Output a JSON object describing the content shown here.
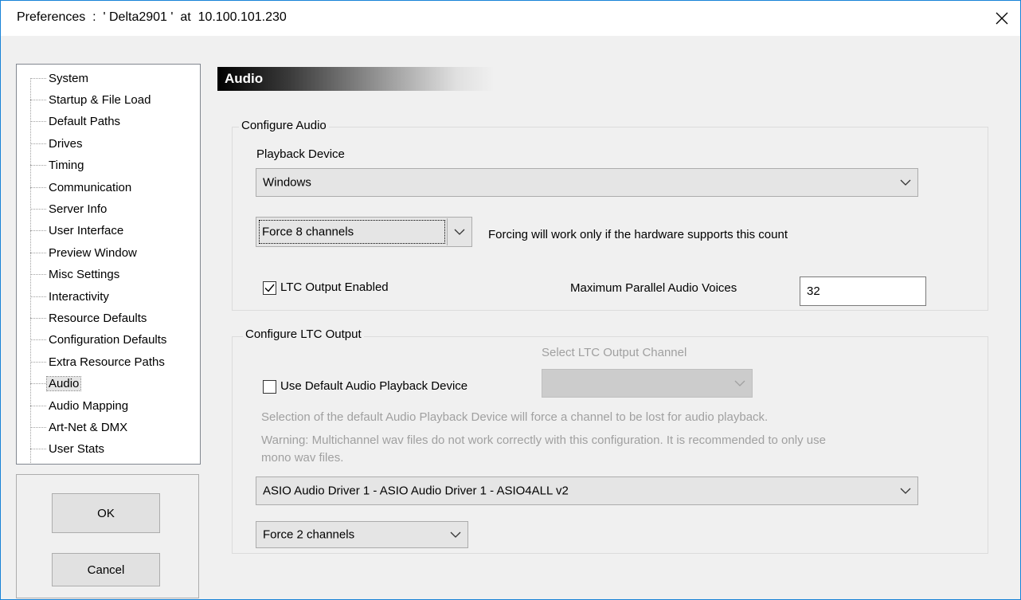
{
  "window": {
    "title": "Preferences  :  ' Delta2901 '  at  10.100.101.230"
  },
  "nav": {
    "items": [
      {
        "label": "System"
      },
      {
        "label": "Startup & File Load"
      },
      {
        "label": "Default Paths"
      },
      {
        "label": "Drives"
      },
      {
        "label": "Timing"
      },
      {
        "label": "Communication"
      },
      {
        "label": "Server Info"
      },
      {
        "label": "User Interface"
      },
      {
        "label": "Preview Window"
      },
      {
        "label": "Misc Settings"
      },
      {
        "label": "Interactivity"
      },
      {
        "label": "Resource Defaults"
      },
      {
        "label": "Configuration Defaults"
      },
      {
        "label": "Extra Resource Paths"
      },
      {
        "label": "Audio",
        "selected": true
      },
      {
        "label": "Audio Mapping"
      },
      {
        "label": "Art-Net & DMX"
      },
      {
        "label": "User Stats"
      }
    ]
  },
  "buttons": {
    "ok": "OK",
    "cancel": "Cancel"
  },
  "section": {
    "title": "Audio"
  },
  "configure_audio": {
    "group_label": "Configure Audio",
    "playback_device_label": "Playback Device",
    "playback_device_value": "Windows",
    "channels_value": "Force 8 channels",
    "channels_note": "Forcing will work only if the hardware supports this count",
    "ltc_enabled_label": "LTC Output Enabled",
    "ltc_enabled_checked": true,
    "max_voices_label": "Maximum Parallel Audio Voices",
    "max_voices_value": "32"
  },
  "configure_ltc": {
    "group_label": "Configure LTC Output",
    "select_channel_label": "Select LTC Output Channel",
    "use_default_label": "Use Default Audio Playback Device",
    "use_default_checked": false,
    "note1": "Selection of the default Audio Playback Device will force a channel to be lost for audio playback.",
    "note2_line1": "Warning: Multichannel wav files do not work correctly with this configuration. It is recommended to only use",
    "note2_line2": "mono wav files.",
    "driver_value": "ASIO Audio Driver 1 - ASIO Audio Driver 1 - ASIO4ALL v2",
    "channels_value": "Force 2 channels"
  },
  "icons": {
    "close": "close-icon",
    "dropdown": "chevron-down-icon",
    "check": "checkmark-icon"
  },
  "colors": {
    "window_border": "#1883d7",
    "dialog_bg": "#f0f0f0",
    "disabled_text": "#a0a0a0"
  }
}
